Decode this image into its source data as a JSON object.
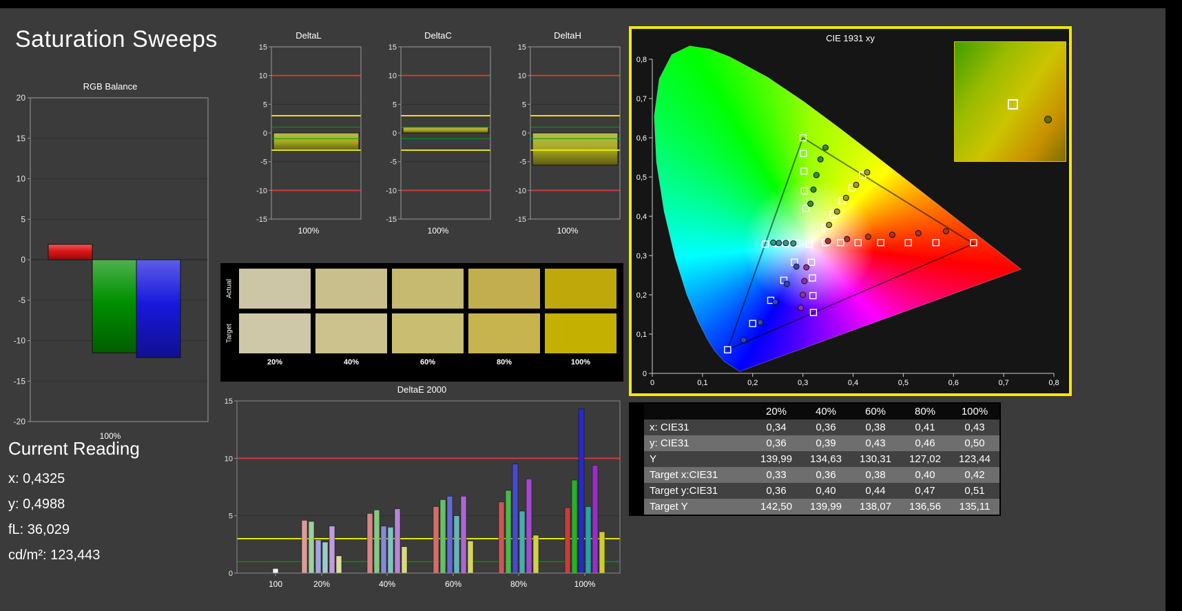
{
  "title": "Saturation Sweeps",
  "current_reading": {
    "heading": "Current Reading",
    "lines": [
      "x: 0,4325",
      "y: 0,4988",
      "fL: 36,029",
      "cd/m²: 123,443"
    ]
  },
  "limit_colors": {
    "red": "#cd3d3d",
    "yellow": "#e6e600",
    "green": "#00a000"
  },
  "chart_data": [
    {
      "id": "rgb_balance",
      "type": "bar",
      "title": "RGB Balance",
      "x_label": "100%",
      "ylim": [
        -20,
        20
      ],
      "ystep": 5,
      "series": [
        {
          "name": "red",
          "value": 1.9,
          "color": "#dd1515"
        },
        {
          "name": "green",
          "value": -11.5,
          "color": "#009000"
        },
        {
          "name": "blue",
          "value": -12.1,
          "color": "#1818dd"
        }
      ]
    },
    {
      "id": "delta_l",
      "type": "bar",
      "title": "DeltaL",
      "x_label": "100%",
      "ylim": [
        -15,
        15
      ],
      "ystep": 5,
      "value": -3.1,
      "bar_color": "#a8a820",
      "limits": {
        "green": 1,
        "yellow": 3,
        "red": 10
      }
    },
    {
      "id": "delta_c",
      "type": "bar",
      "title": "DeltaC",
      "x_label": "100%",
      "ylim": [
        -15,
        15
      ],
      "ystep": 5,
      "value": 1.0,
      "bar_color": "#a8a820",
      "limits": {
        "green": 1,
        "yellow": 3,
        "red": 10
      }
    },
    {
      "id": "delta_h",
      "type": "bar",
      "title": "DeltaH",
      "x_label": "100%",
      "ylim": [
        -15,
        15
      ],
      "ystep": 5,
      "value": -5.6,
      "bar_color": "#a8a820",
      "limits": {
        "green": 1,
        "yellow": 3,
        "red": 10
      }
    },
    {
      "id": "deltae_2000",
      "type": "bar",
      "title": "DeltaE 2000",
      "ylim": [
        0,
        15
      ],
      "ystep": 5,
      "limits": {
        "green": 1,
        "yellow": 3,
        "red": 10
      },
      "groups": [
        {
          "label": "100",
          "values": [
            0.4
          ],
          "colors": [
            "#f0f0f0"
          ]
        },
        {
          "label": "20%",
          "values": [
            4.6,
            4.5,
            2.9,
            2.7,
            4.1,
            1.5
          ],
          "colors": [
            "#dc9b9b",
            "#9ecf9e",
            "#a4a4de",
            "#9ccaca",
            "#c29cdc",
            "#dcdc9e"
          ]
        },
        {
          "label": "40%",
          "values": [
            5.2,
            5.5,
            4.1,
            4.0,
            5.6,
            2.3
          ],
          "colors": [
            "#d88585",
            "#84c884",
            "#8888da",
            "#84c0c0",
            "#b884d8",
            "#d8d884"
          ]
        },
        {
          "label": "60%",
          "values": [
            5.8,
            6.4,
            6.7,
            5.0,
            6.7,
            2.8
          ],
          "colors": [
            "#d46c6c",
            "#66c066",
            "#6868d6",
            "#66b6b6",
            "#ae66d4",
            "#d4d466"
          ]
        },
        {
          "label": "80%",
          "values": [
            6.2,
            7.2,
            9.5,
            5.4,
            8.2,
            3.3
          ],
          "colors": [
            "#d05454",
            "#4ab84a",
            "#4848d2",
            "#4aacac",
            "#a44ad0",
            "#d0d04a"
          ]
        },
        {
          "label": "100%",
          "values": [
            5.7,
            8.1,
            14.3,
            5.8,
            9.4,
            3.6
          ],
          "colors": [
            "#cc3a3a",
            "#2cae2c",
            "#2828ce",
            "#2ca2a2",
            "#9a2ccc",
            "#cccc2c"
          ]
        }
      ]
    },
    {
      "id": "cie_1931",
      "type": "scatter",
      "title": "CIE 1931 xy",
      "xlim": [
        0,
        0.8
      ],
      "ylim": [
        0,
        0.8
      ],
      "x_tick_labels": [
        "0",
        "0,1",
        "0,2",
        "0,3",
        "0,4",
        "0,5",
        "0,6",
        "0,7",
        "0,8"
      ],
      "y_tick_labels": [
        "0",
        "0,1",
        "0,2",
        "0,3",
        "0,4",
        "0,5",
        "0,6",
        "0,7",
        "0,8"
      ],
      "gamut_triangle": [
        [
          0.64,
          0.33
        ],
        [
          0.3,
          0.6
        ],
        [
          0.15,
          0.06
        ]
      ],
      "white_point": [
        0.313,
        0.329
      ],
      "target_points": [
        [
          0.313,
          0.329
        ],
        [
          0.345,
          0.333
        ],
        [
          0.375,
          0.333
        ],
        [
          0.41,
          0.333
        ],
        [
          0.455,
          0.333
        ],
        [
          0.51,
          0.333
        ],
        [
          0.565,
          0.333
        ],
        [
          0.64,
          0.333
        ],
        [
          0.287,
          0.331
        ],
        [
          0.266,
          0.331
        ],
        [
          0.246,
          0.331
        ],
        [
          0.225,
          0.329
        ],
        [
          0.306,
          0.42
        ],
        [
          0.303,
          0.465
        ],
        [
          0.302,
          0.515
        ],
        [
          0.301,
          0.56
        ],
        [
          0.3,
          0.6
        ],
        [
          0.283,
          0.283
        ],
        [
          0.262,
          0.237
        ],
        [
          0.236,
          0.186
        ],
        [
          0.2,
          0.127
        ],
        [
          0.15,
          0.06
        ],
        [
          0.317,
          0.283
        ],
        [
          0.319,
          0.243
        ],
        [
          0.32,
          0.198
        ],
        [
          0.321,
          0.155
        ],
        [
          0.344,
          0.372
        ],
        [
          0.36,
          0.405
        ],
        [
          0.378,
          0.44
        ],
        [
          0.398,
          0.472
        ],
        [
          0.419,
          0.505
        ]
      ],
      "measured_series": [
        {
          "name": "red",
          "color": "#b03030",
          "points": [
            [
              0.35,
              0.337
            ],
            [
              0.388,
              0.342
            ],
            [
              0.43,
              0.348
            ],
            [
              0.478,
              0.353
            ],
            [
              0.53,
              0.357
            ],
            [
              0.585,
              0.362
            ]
          ]
        },
        {
          "name": "green",
          "color": "#2e8f2e",
          "points": [
            [
              0.315,
              0.432
            ],
            [
              0.321,
              0.468
            ],
            [
              0.327,
              0.505
            ],
            [
              0.335,
              0.545
            ],
            [
              0.345,
              0.575
            ]
          ]
        },
        {
          "name": "blue",
          "color": "#3545b5",
          "points": [
            [
              0.287,
              0.272
            ],
            [
              0.268,
              0.228
            ],
            [
              0.245,
              0.182
            ],
            [
              0.215,
              0.13
            ],
            [
              0.182,
              0.085
            ]
          ]
        },
        {
          "name": "magenta",
          "color": "#9a309a",
          "points": [
            [
              0.307,
              0.27
            ],
            [
              0.303,
              0.235
            ],
            [
              0.3,
              0.2
            ],
            [
              0.296,
              0.167
            ]
          ]
        },
        {
          "name": "cyan",
          "color": "#2f9b9b",
          "points": [
            [
              0.281,
              0.331
            ],
            [
              0.266,
              0.332
            ],
            [
              0.252,
              0.332
            ],
            [
              0.241,
              0.333
            ]
          ]
        },
        {
          "name": "yellow",
          "color": "#9b9b2a",
          "points": [
            [
              0.352,
              0.378
            ],
            [
              0.368,
              0.412
            ],
            [
              0.386,
              0.447
            ],
            [
              0.406,
              0.48
            ],
            [
              0.428,
              0.512
            ]
          ]
        }
      ]
    }
  ],
  "swatch_panel": {
    "row_labels": [
      "Actual",
      "Target"
    ],
    "column_labels": [
      "20%",
      "40%",
      "60%",
      "80%",
      "100%"
    ],
    "actual_colors": [
      "#ccc6a6",
      "#c9bf8c",
      "#c6b970",
      "#c2ae4e",
      "#bfa80a"
    ],
    "target_colors": [
      "#cec8a8",
      "#ccc28e",
      "#c9bd72",
      "#c7b44e",
      "#c4b000"
    ]
  },
  "table": {
    "column_headers": [
      "20%",
      "40%",
      "60%",
      "80%",
      "100%"
    ],
    "rows": [
      {
        "label": "x: CIE31",
        "values": [
          "0,34",
          "0,36",
          "0,38",
          "0,41",
          "0,43"
        ]
      },
      {
        "label": "y: CIE31",
        "values": [
          "0,36",
          "0,39",
          "0,43",
          "0,46",
          "0,50"
        ]
      },
      {
        "label": "Y",
        "values": [
          "139,99",
          "134,63",
          "130,31",
          "127,02",
          "123,44"
        ]
      },
      {
        "label": "Target x:CIE31",
        "values": [
          "0,33",
          "0,36",
          "0,38",
          "0,40",
          "0,42"
        ]
      },
      {
        "label": "Target y:CIE31",
        "values": [
          "0,36",
          "0,40",
          "0,44",
          "0,47",
          "0,51"
        ]
      },
      {
        "label": "Target Y",
        "values": [
          "142,50",
          "139,99",
          "138,07",
          "136,56",
          "135,11"
        ]
      }
    ]
  }
}
